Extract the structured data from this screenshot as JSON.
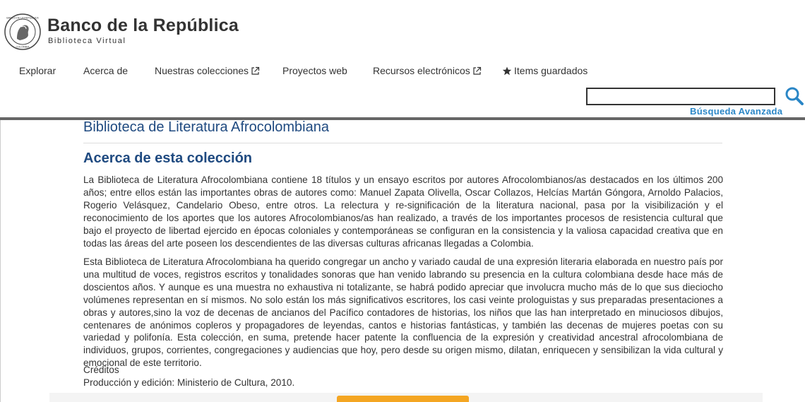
{
  "header": {
    "brand_title": "Banco de la República",
    "brand_subtitle": "Biblioteca Virtual",
    "logo_text": "BANCO DE LA REPÚBLICA COLOMBIA"
  },
  "nav": {
    "items": [
      {
        "label": "Explorar",
        "icon": ""
      },
      {
        "label": "Acerca de",
        "icon": ""
      },
      {
        "label": "Nuestras colecciones",
        "icon": "external-link-icon"
      },
      {
        "label": "Proyectos web",
        "icon": ""
      },
      {
        "label": "Recursos electrónicos",
        "icon": "external-link-icon"
      },
      {
        "label": "Items guardados",
        "icon": "star-icon"
      }
    ]
  },
  "search": {
    "value": "",
    "button_icon": "search-icon",
    "advanced_label": "Búsqueda Avanzada"
  },
  "main": {
    "page_title": "Biblioteca de Literatura Afrocolombiana",
    "section_title": "Acerca de esta colección",
    "paragraph1": "La Biblioteca de Literatura Afrocolombiana contiene 18 títulos y un ensayo escritos por autores Afrocolombianos/as destacados en los últimos 200 años; entre ellos están las importantes obras de autores como: Manuel Zapata Olivella, Oscar Collazos, Helcías Martán Góngora, Arnoldo Palacios, Rogerio Velásquez, Candelario Obeso, entre otros. La relectura y re-significación de la literatura nacional, pasa por la visibilización y el reconocimiento de los aportes que los autores Afrocolombianos/as han realizado, a través de los importantes procesos de resistencia cultural que bajo el proyecto de libertad ejercido en épocas coloniales y contemporáneas se configuran en la consistencia y la valiosa capacidad creativa que en todas las áreas del arte poseen los descendientes de las diversas culturas africanas llegadas a Colombia.",
    "paragraph2": "Esta Biblioteca de Literatura Afrocolombiana ha querido congregar un ancho y variado caudal de una expresión literaria elaborada en nuestro país por una multitud de voces, registros escritos y tonalidades sonoras que han venido labrando su presencia en la cultura colombiana desde hace más de doscientos años. Y aunque es una muestra no exhaustiva ni totalizante, se habrá podido apreciar que involucra mucho más de lo que sus dieciocho volúmenes representan en sí mismos. No solo están los más significativos escritores, los casi veinte prologuistas y sus preparadas presentaciones a obras y autores,sino la voz de decenas de ancianos del Pacífico contadores de historias, los niños que las han interpretado en minuciosos dibujos, centenares de anónimos copleros y propagadores de leyendas, cantos e historias fantásticas, y también las decenas de mujeres poetas con su variedad y polifonía. Esta colección, en suma, pretende hacer patente la confluencia de la expresión y creatividad ancestral afrocolombiana de individuos, grupos, corrientes, congregaciones y audiencias que hoy, pero desde su origen mismo, dilatan, enriquecen y sensibilizan la vida cultural y emocional de este territorio.",
    "credits_label": "Créditos",
    "credits_text": "Producción y edición: Ministerio de Cultura, 2010."
  },
  "colors": {
    "title_blue": "#1f4a80",
    "link_blue": "#2a86c6",
    "button_orange": "#f4a623",
    "text": "#333333"
  }
}
